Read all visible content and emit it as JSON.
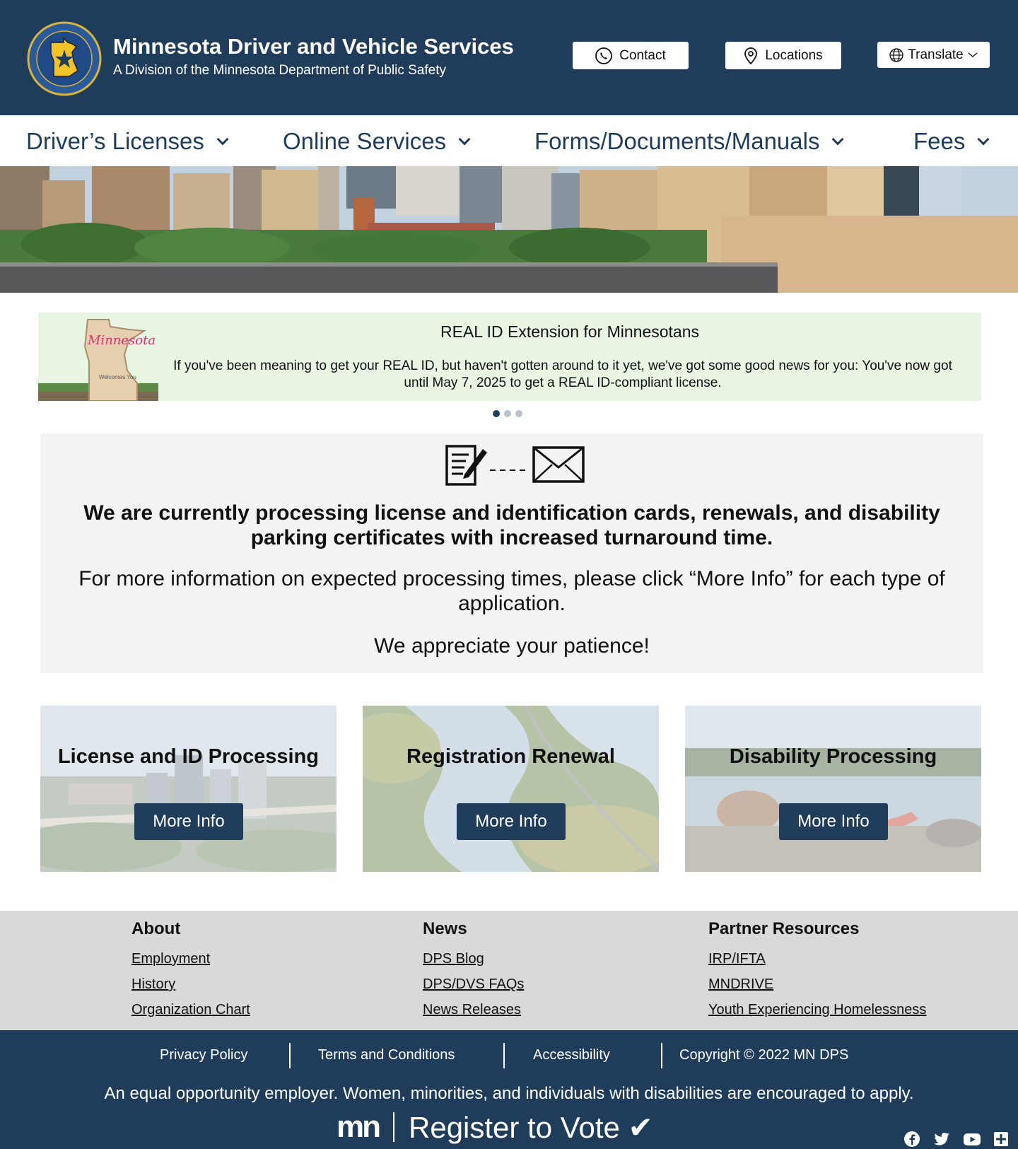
{
  "header": {
    "title": "Minnesota Driver and Vehicle Services",
    "subtitle": "A Division of the Minnesota Department of Public Safety",
    "seal_text_top": "DEPARTMENT OF PUBLIC SAFETY",
    "seal_text_bottom": "STATE OF MINNESOTA",
    "contact_label": "Contact",
    "locations_label": "Locations",
    "translate_label": "Translate"
  },
  "nav": {
    "items": [
      {
        "label": "Driver’s Licenses"
      },
      {
        "label": "Online Services"
      },
      {
        "label": "Forms/Documents/Manuals"
      },
      {
        "label": "Fees"
      }
    ]
  },
  "carousel": {
    "title": "REAL ID Extension for Minnesotans",
    "text": "If you've been meaning to get your REAL ID, but haven't gotten around to it yet, we've got some good news for you: You've now got until May 7, 2025 to get a REAL ID-compliant license.",
    "sign_text": "Minnesota",
    "sign_sub": "Welcomes You",
    "slide_count": 3,
    "active_slide": 1
  },
  "notice": {
    "heading": "We are currently processing license and identification cards, renewals, and disability parking certificates with increased turnaround time.",
    "body": "For more information on expected processing times, please click “More Info” for each type of application.",
    "closing": "We appreciate your patience!"
  },
  "cards": [
    {
      "title": "License and ID Processing",
      "button": "More Info"
    },
    {
      "title": "Registration Renewal",
      "button": "More Info"
    },
    {
      "title": "Disability Processing",
      "button": "More Info"
    }
  ],
  "footer": {
    "columns": [
      {
        "heading": "About",
        "links": [
          "Employment",
          "History",
          "Organization Chart"
        ]
      },
      {
        "heading": "News",
        "links": [
          "DPS Blog",
          "DPS/DVS FAQs",
          "News Releases"
        ]
      },
      {
        "heading": "Partner Resources",
        "links": [
          "IRP/IFTA",
          "MNDRIVE",
          "Youth Experiencing Homelessness"
        ]
      }
    ],
    "legal": {
      "privacy": "Privacy Policy",
      "terms": "Terms and Conditions",
      "accessibility": "Accessibility",
      "copyright": "Copyright © 2022 MN DPS"
    },
    "eoe": "An equal opportunity employer. Women, minorities, and individuals with disabilities are encouraged to apply.",
    "vote_logo": "mn",
    "vote_label": "Register to Vote ✔",
    "social_icons": [
      "facebook-icon",
      "twitter-icon",
      "youtube-icon",
      "plus-icon"
    ]
  },
  "colors": {
    "brand_navy": "#1f3d5a",
    "banner_green": "#e9f5e3",
    "notice_gray": "#f3f3f3",
    "footer_gray": "#d9d9d9"
  }
}
